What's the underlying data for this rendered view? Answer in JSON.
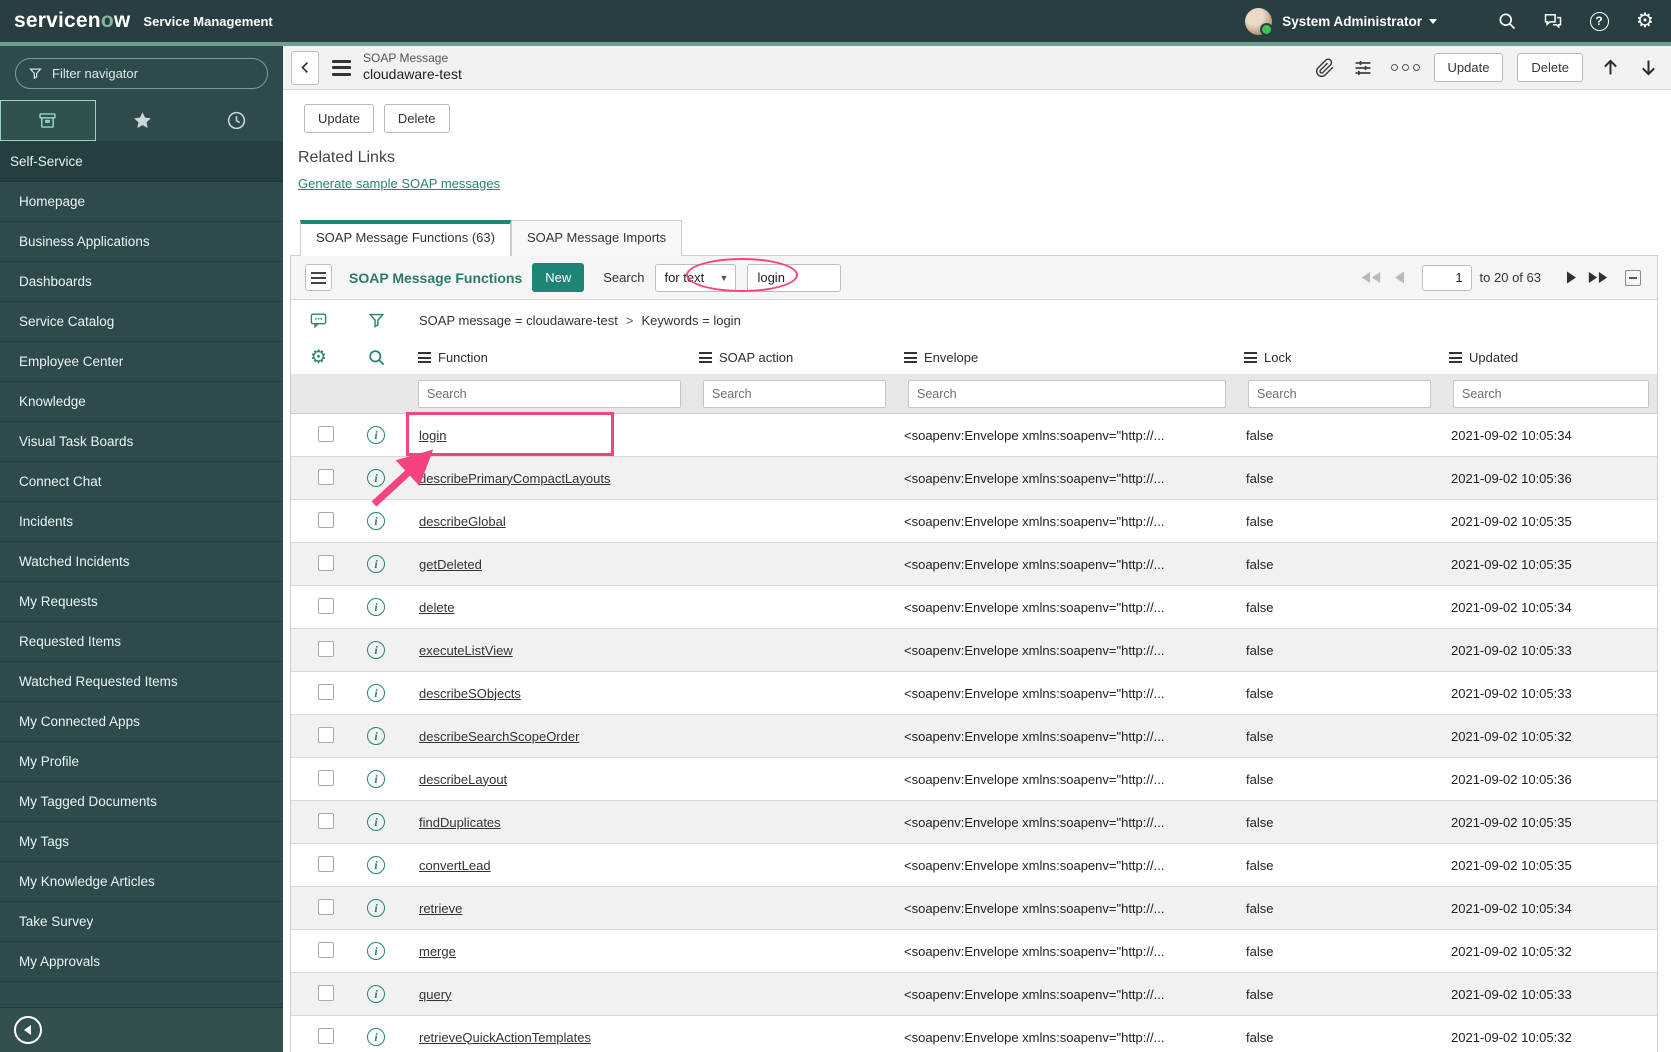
{
  "banner": {
    "logo_prefix": "servicen",
    "logo_o": "o",
    "logo_suffix": "w",
    "product": "Service Management",
    "user_name": "System Administrator"
  },
  "sidebar": {
    "filter_placeholder": "Filter navigator",
    "section_header": "Self-Service",
    "items": [
      "Homepage",
      "Business Applications",
      "Dashboards",
      "Service Catalog",
      "Employee Center",
      "Knowledge",
      "Visual Task Boards",
      "Connect Chat",
      "Incidents",
      "Watched Incidents",
      "My Requests",
      "Requested Items",
      "Watched Requested Items",
      "My Connected Apps",
      "My Profile",
      "My Tagged Documents",
      "My Tags",
      "My Knowledge Articles",
      "Take Survey",
      "My Approvals"
    ]
  },
  "form_header": {
    "record_type": "SOAP Message",
    "record_name": "cloudaware-test",
    "update_label": "Update",
    "delete_label": "Delete"
  },
  "page": {
    "update_label": "Update",
    "delete_label": "Delete",
    "related_links_title": "Related Links",
    "related_link_label": "Generate sample SOAP messages",
    "tab_functions": "SOAP Message Functions (63)",
    "tab_imports": "SOAP Message Imports"
  },
  "list": {
    "title": "SOAP Message Functions",
    "new_label": "New",
    "search_label": "Search",
    "search_type_value": "for text",
    "search_value": "login",
    "page_value": "1",
    "page_info": "to 20 of 63",
    "breadcrumb_filter": "SOAP message = cloudaware-test",
    "breadcrumb_separator": ">",
    "breadcrumb_keywords": "Keywords = login",
    "columns": [
      "Function",
      "SOAP action",
      "Envelope",
      "Lock",
      "Updated"
    ],
    "cell_search_placeholder": "Search",
    "rows": [
      {
        "function": "login",
        "soap_action": "",
        "envelope": "<soapenv:Envelope xmlns:soapenv=\"http://...",
        "lock": "false",
        "updated": "2021-09-02 10:05:34"
      },
      {
        "function": "describePrimaryCompactLayouts",
        "soap_action": "",
        "envelope": "<soapenv:Envelope xmlns:soapenv=\"http://...",
        "lock": "false",
        "updated": "2021-09-02 10:05:36"
      },
      {
        "function": "describeGlobal",
        "soap_action": "",
        "envelope": "<soapenv:Envelope xmlns:soapenv=\"http://...",
        "lock": "false",
        "updated": "2021-09-02 10:05:35"
      },
      {
        "function": "getDeleted",
        "soap_action": "",
        "envelope": "<soapenv:Envelope xmlns:soapenv=\"http://...",
        "lock": "false",
        "updated": "2021-09-02 10:05:35"
      },
      {
        "function": "delete",
        "soap_action": "",
        "envelope": "<soapenv:Envelope xmlns:soapenv=\"http://...",
        "lock": "false",
        "updated": "2021-09-02 10:05:34"
      },
      {
        "function": "executeListView",
        "soap_action": "",
        "envelope": "<soapenv:Envelope xmlns:soapenv=\"http://...",
        "lock": "false",
        "updated": "2021-09-02 10:05:33"
      },
      {
        "function": "describeSObjects",
        "soap_action": "",
        "envelope": "<soapenv:Envelope xmlns:soapenv=\"http://...",
        "lock": "false",
        "updated": "2021-09-02 10:05:33"
      },
      {
        "function": "describeSearchScopeOrder",
        "soap_action": "",
        "envelope": "<soapenv:Envelope xmlns:soapenv=\"http://...",
        "lock": "false",
        "updated": "2021-09-02 10:05:32"
      },
      {
        "function": "describeLayout",
        "soap_action": "",
        "envelope": "<soapenv:Envelope xmlns:soapenv=\"http://...",
        "lock": "false",
        "updated": "2021-09-02 10:05:36"
      },
      {
        "function": "findDuplicates",
        "soap_action": "",
        "envelope": "<soapenv:Envelope xmlns:soapenv=\"http://...",
        "lock": "false",
        "updated": "2021-09-02 10:05:35"
      },
      {
        "function": "convertLead",
        "soap_action": "",
        "envelope": "<soapenv:Envelope xmlns:soapenv=\"http://...",
        "lock": "false",
        "updated": "2021-09-02 10:05:35"
      },
      {
        "function": "retrieve",
        "soap_action": "",
        "envelope": "<soapenv:Envelope xmlns:soapenv=\"http://...",
        "lock": "false",
        "updated": "2021-09-02 10:05:34"
      },
      {
        "function": "merge",
        "soap_action": "",
        "envelope": "<soapenv:Envelope xmlns:soapenv=\"http://...",
        "lock": "false",
        "updated": "2021-09-02 10:05:32"
      },
      {
        "function": "query",
        "soap_action": "",
        "envelope": "<soapenv:Envelope xmlns:soapenv=\"http://...",
        "lock": "false",
        "updated": "2021-09-02 10:05:33"
      },
      {
        "function": "retrieveQuickActionTemplates",
        "soap_action": "",
        "envelope": "<soapenv:Envelope xmlns:soapenv=\"http://...",
        "lock": "false",
        "updated": "2021-09-02 10:05:32"
      }
    ]
  },
  "colors": {
    "accent_teal": "#1f8476",
    "banner_dark": "#293e40",
    "sidebar_dark": "#2e4a4d",
    "annotation_pink": "#f5437e"
  }
}
